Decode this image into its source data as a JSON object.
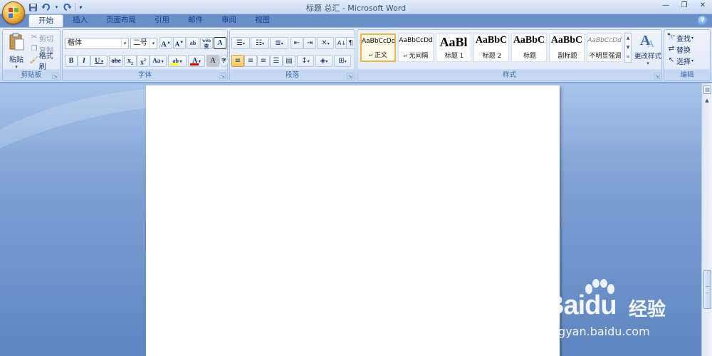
{
  "window": {
    "title": "标题 总汇 - Microsoft Word",
    "controls": [
      "—",
      "❐",
      "✕"
    ]
  },
  "qat": {
    "save": "save-icon",
    "undo": "undo-icon",
    "redo": "redo-icon",
    "customize": "▾"
  },
  "tabs": [
    "开始",
    "插入",
    "页面布局",
    "引用",
    "邮件",
    "审阅",
    "视图"
  ],
  "active_tab": "开始",
  "help": "?",
  "clipboard": {
    "label": "剪贴板",
    "paste": "粘贴",
    "cut": "剪切",
    "copy": "复制",
    "format_painter": "格式刷"
  },
  "font": {
    "label": "字体",
    "name": "楷体",
    "size": "二号",
    "grow": "A",
    "shrink": "A",
    "clear": "ab",
    "phonetic": "wén",
    "border_char": "A",
    "bold": "B",
    "italic": "I",
    "underline": "U",
    "strike": "abe",
    "subscript": "x",
    "superscript": "x",
    "change_case": "Aa",
    "highlight": "ab",
    "font_color": "A",
    "shading_char": "A",
    "enclose": "字"
  },
  "paragraph": {
    "label": "段落"
  },
  "styles": {
    "label": "样式",
    "items": [
      {
        "sample": "AaBbCcDd",
        "name": "正文",
        "prefix": "↵",
        "size": 9,
        "bold": false,
        "italic": false,
        "color": "#000000"
      },
      {
        "sample": "AaBbCcDd",
        "name": "无间隔",
        "prefix": "↵",
        "size": 9,
        "bold": false,
        "italic": false,
        "color": "#000000"
      },
      {
        "sample": "AaBl",
        "name": "标题 1",
        "prefix": "",
        "size": 18,
        "bold": true,
        "italic": false,
        "color": "#000000"
      },
      {
        "sample": "AaBbC",
        "name": "标题 2",
        "prefix": "",
        "size": 14,
        "bold": true,
        "italic": false,
        "color": "#000000"
      },
      {
        "sample": "AaBbC",
        "name": "标题",
        "prefix": "",
        "size": 14,
        "bold": true,
        "italic": false,
        "color": "#000000"
      },
      {
        "sample": "AaBbC",
        "name": "副标题",
        "prefix": "",
        "size": 14,
        "bold": true,
        "italic": false,
        "color": "#000000"
      },
      {
        "sample": "AaBbCcDd",
        "name": "不明显强调",
        "prefix": "",
        "size": 9,
        "bold": false,
        "italic": true,
        "color": "#7f7f7f"
      }
    ],
    "change_styles": "更改样式"
  },
  "editing": {
    "label": "编辑",
    "find": "查找",
    "replace": "替换",
    "select": "选择"
  },
  "watermark": {
    "logo": "Bai",
    "logo_du": "du",
    "cn": "经验",
    "url": "jingyan.baidu.com"
  },
  "colors": {
    "highlight": "#ffff00",
    "font_color": "#e00000",
    "accent": "#f0b44e"
  }
}
